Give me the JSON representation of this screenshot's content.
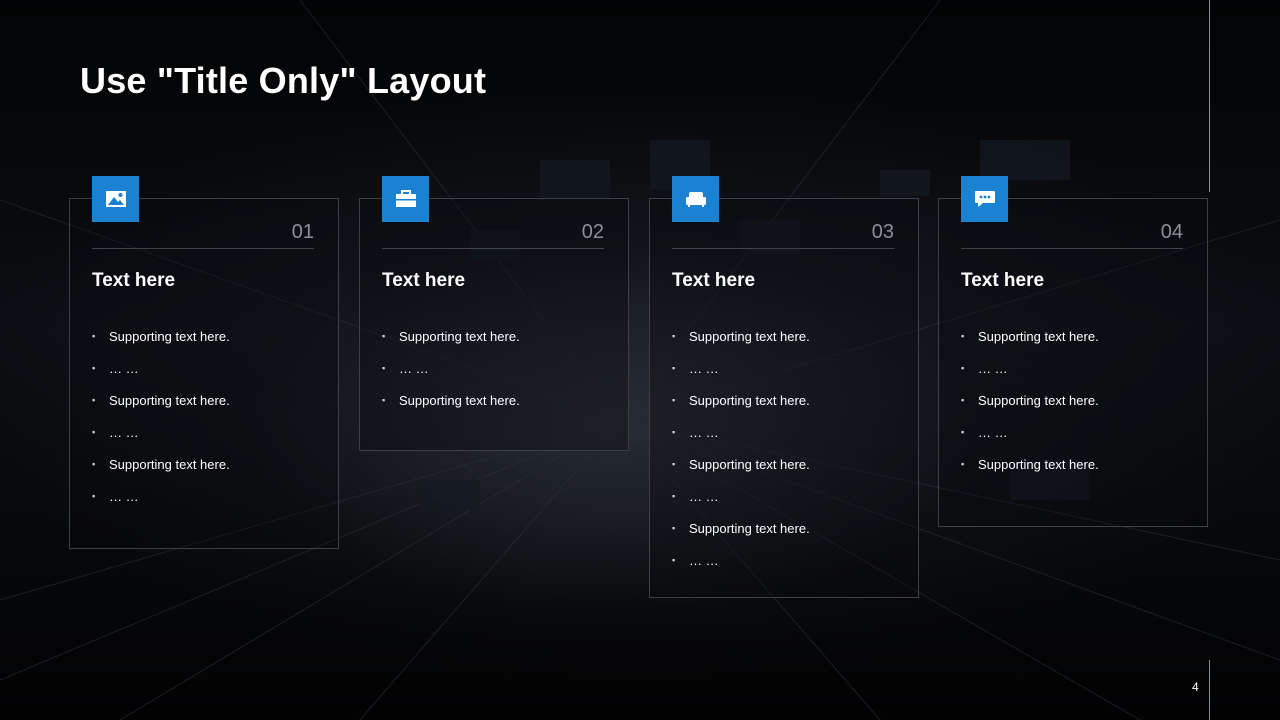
{
  "slide": {
    "title": "Use \"Title Only\" Layout",
    "page_number": "4",
    "accent_color": "#1a82d1"
  },
  "cards": [
    {
      "number": "01",
      "heading": "Text here",
      "icon": "image-icon",
      "items": [
        "Supporting  text here.",
        "… …",
        "Supporting  text here.",
        "… …",
        "Supporting  text here.",
        "… …"
      ]
    },
    {
      "number": "02",
      "heading": "Text here",
      "icon": "briefcase-icon",
      "items": [
        "Supporting  text here.",
        "… …",
        "Supporting  text here."
      ]
    },
    {
      "number": "03",
      "heading": "Text here",
      "icon": "armchair-icon",
      "items": [
        "Supporting  text here.",
        "… …",
        "Supporting  text here.",
        "… …",
        "Supporting  text here.",
        "… …",
        "Supporting  text here.",
        "… …"
      ]
    },
    {
      "number": "04",
      "heading": "Text here",
      "icon": "chat-bubble-icon",
      "items": [
        "Supporting  text here.",
        "… …",
        "Supporting  text here.",
        "… …",
        "Supporting  text here."
      ]
    }
  ]
}
